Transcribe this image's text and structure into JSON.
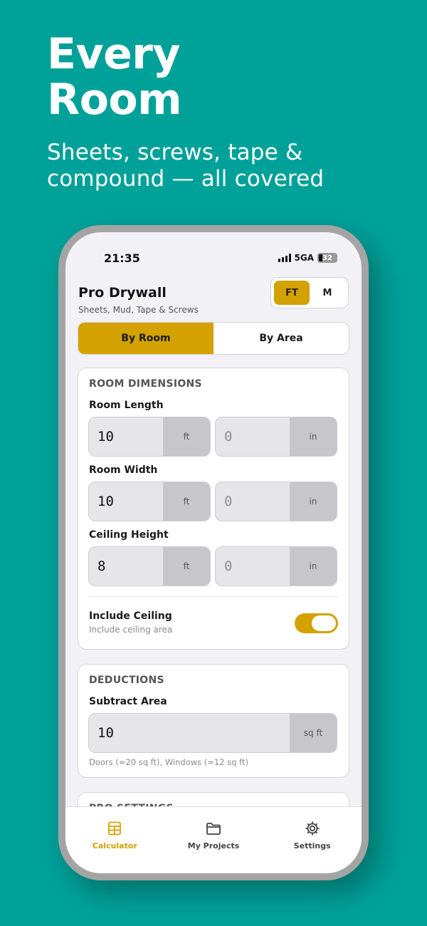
{
  "promo": {
    "headline_line1": "Every",
    "headline_line2": "Room",
    "subheadline": "Sheets, screws, tape & compound — all covered"
  },
  "status_bar": {
    "time": "21:35",
    "network": "5GA",
    "battery": "32"
  },
  "app": {
    "title": "Pro Drywall",
    "subtitle": "Sheets, Mud, Tape & Screws",
    "unit_toggle": {
      "options": [
        "FT",
        "M"
      ],
      "selected": "FT"
    },
    "mode_tabs": {
      "options": [
        "By Room",
        "By Area"
      ],
      "selected": "By Room"
    }
  },
  "room_dimensions": {
    "title": "ROOM DIMENSIONS",
    "fields": [
      {
        "label": "Room Length",
        "ft_value": "10",
        "ft_unit": "ft",
        "in_placeholder": "0",
        "in_unit": "in"
      },
      {
        "label": "Room Width",
        "ft_value": "10",
        "ft_unit": "ft",
        "in_placeholder": "0",
        "in_unit": "in"
      },
      {
        "label": "Ceiling Height",
        "ft_value": "8",
        "ft_unit": "ft",
        "in_placeholder": "0",
        "in_unit": "in"
      }
    ],
    "include_ceiling": {
      "label": "Include Ceiling",
      "sub": "Include ceiling area",
      "on": true
    }
  },
  "deductions": {
    "title": "DEDUCTIONS",
    "label": "Subtract Area",
    "value": "10",
    "unit": "sq ft",
    "hint": "Doors (≈20 sq ft), Windows (≈12 sq ft)"
  },
  "pro_settings": {
    "title": "PRO SETTINGS"
  },
  "tabbar": {
    "items": [
      {
        "label": "Calculator",
        "icon": "calculator-icon",
        "active": true
      },
      {
        "label": "My Projects",
        "icon": "folder-icon",
        "active": false
      },
      {
        "label": "Settings",
        "icon": "gear-icon",
        "active": false
      }
    ]
  },
  "colors": {
    "background": "#00a199",
    "accent": "#d3a100"
  }
}
